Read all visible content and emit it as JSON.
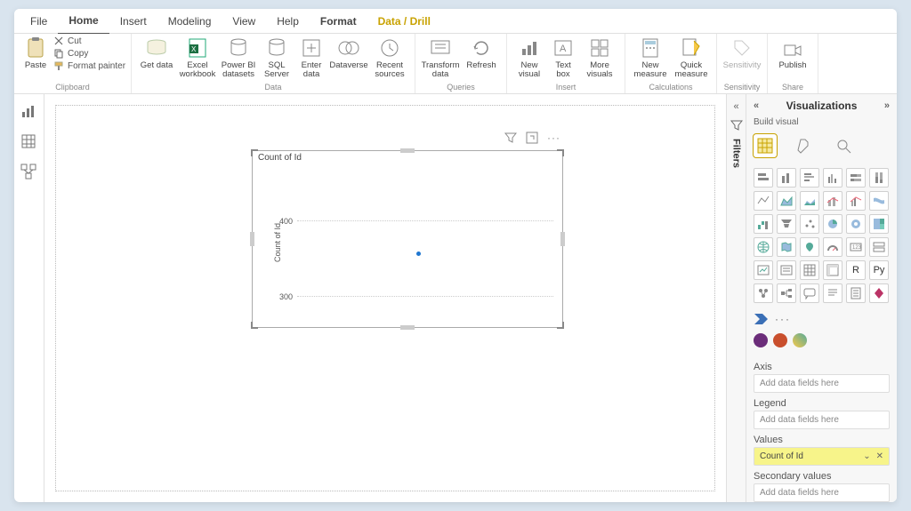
{
  "tabs": {
    "file": "File",
    "home": "Home",
    "insert": "Insert",
    "modeling": "Modeling",
    "view": "View",
    "help": "Help",
    "format": "Format",
    "datadrill": "Data / Drill"
  },
  "ribbon": {
    "clipboard": {
      "label": "Clipboard",
      "paste": "Paste",
      "cut": "Cut",
      "copy": "Copy",
      "formatpainter": "Format painter"
    },
    "data": {
      "label": "Data",
      "getdata": "Get\ndata",
      "excel": "Excel\nworkbook",
      "pbi": "Power BI\ndatasets",
      "sql": "SQL\nServer",
      "enter": "Enter\ndata",
      "dataverse": "Dataverse",
      "recent": "Recent\nsources"
    },
    "queries": {
      "label": "Queries",
      "transform": "Transform\ndata",
      "refresh": "Refresh"
    },
    "insert": {
      "label": "Insert",
      "newvisual": "New\nvisual",
      "textbox": "Text\nbox",
      "more": "More\nvisuals"
    },
    "calc": {
      "label": "Calculations",
      "newmeasure": "New\nmeasure",
      "quick": "Quick\nmeasure"
    },
    "sensitivity": {
      "label": "Sensitivity",
      "btn": "Sensitivity"
    },
    "share": {
      "label": "Share",
      "btn": "Publish"
    }
  },
  "filtersCollapsed": "Filters",
  "viz": {
    "title": "Visualizations",
    "subtitle": "Build visual",
    "wells": {
      "axis": "Axis",
      "axis_ph": "Add data fields here",
      "legend": "Legend",
      "legend_ph": "Add data fields here",
      "values": "Values",
      "values_val": "Count of Id",
      "secondary": "Secondary values",
      "secondary_ph": "Add data fields here"
    }
  },
  "chart_data": {
    "type": "scatter",
    "title": "Count of Id",
    "ylabel": "Count of Id",
    "yticks": [
      300,
      400
    ],
    "ylim": [
      280,
      450
    ],
    "points": [
      {
        "x": 0.5,
        "y": 355
      }
    ]
  }
}
